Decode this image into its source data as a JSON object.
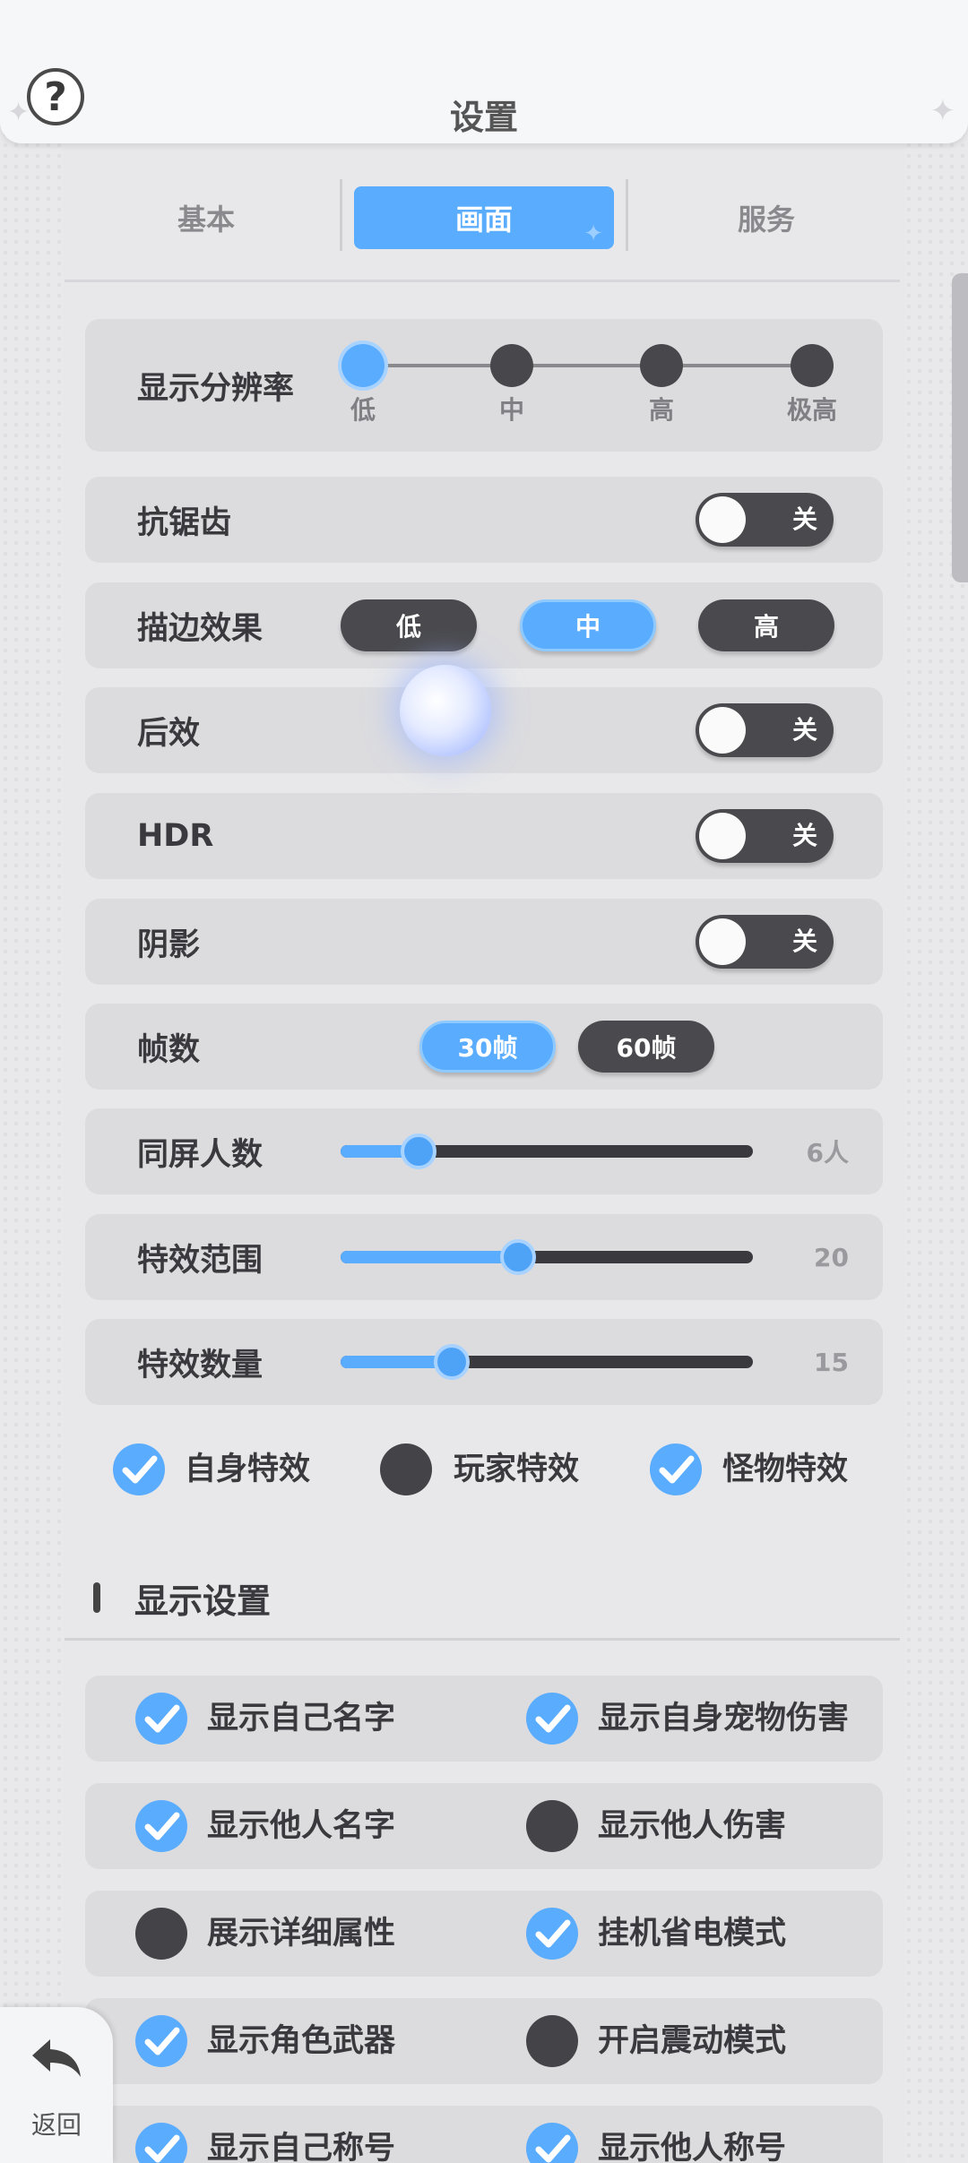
{
  "header": {
    "title": "设置",
    "help_glyph": "?"
  },
  "tabs": [
    {
      "label": "基本",
      "active": false
    },
    {
      "label": "画面",
      "active": true
    },
    {
      "label": "服务",
      "active": false
    }
  ],
  "resolution": {
    "label": "显示分辨率",
    "options": [
      "低",
      "中",
      "高",
      "极高"
    ],
    "selected": "低"
  },
  "anti_alias": {
    "label": "抗锯齿",
    "state": "关"
  },
  "outline": {
    "label": "描边效果",
    "options": [
      "低",
      "中",
      "高"
    ],
    "selected": "中"
  },
  "post_effect": {
    "label": "后效",
    "state": "关"
  },
  "hdr": {
    "label": "HDR",
    "state": "关"
  },
  "shadow": {
    "label": "阴影",
    "state": "关"
  },
  "framerate": {
    "label": "帧数",
    "options": [
      "30帧",
      "60帧"
    ],
    "selected": "30帧"
  },
  "same_screen": {
    "label": "同屏人数",
    "value": "6人",
    "fraction": 0.19
  },
  "effect_range": {
    "label": "特效范围",
    "value": "20",
    "fraction": 0.43
  },
  "effect_count": {
    "label": "特效数量",
    "value": "15",
    "fraction": 0.27
  },
  "effect_checks": [
    {
      "label": "自身特效",
      "checked": true
    },
    {
      "label": "玩家特效",
      "checked": false
    },
    {
      "label": "怪物特效",
      "checked": true
    }
  ],
  "display_section": {
    "title": "显示设置"
  },
  "display_options": [
    {
      "label": "显示自己名字",
      "checked": true
    },
    {
      "label": "显示自身宠物伤害",
      "checked": true
    },
    {
      "label": "显示他人名字",
      "checked": true
    },
    {
      "label": "显示他人伤害",
      "checked": false
    },
    {
      "label": "展示详细属性",
      "checked": false
    },
    {
      "label": "挂机省电模式",
      "checked": true
    },
    {
      "label": "显示角色武器",
      "checked": true
    },
    {
      "label": "开启震动模式",
      "checked": false
    },
    {
      "label": "显示自己称号",
      "checked": true
    },
    {
      "label": "显示他人称号",
      "checked": true
    }
  ],
  "back": {
    "label": "返回"
  },
  "colors": {
    "accent": "#5aacff",
    "dark": "#4a4a4e",
    "row_bg": "#dcdcdf"
  },
  "icons": [
    "help-icon",
    "back-arrow-icon",
    "check-icon",
    "sparkle-icon"
  ]
}
